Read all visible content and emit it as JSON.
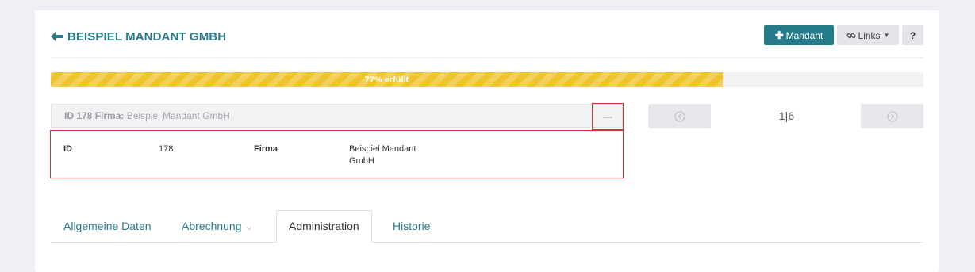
{
  "header": {
    "title": "BEISPIEL MANDANT GMBH",
    "mandant_label": "Mandant",
    "links_label": "Links",
    "help_label": "?"
  },
  "progress": {
    "label": "77% erfüllt",
    "percent": 77,
    "color": "#eec32c"
  },
  "record": {
    "summary_id_label": "ID 178",
    "summary_firma_label": "Firma:",
    "summary_firma_value": "Beispiel Mandant GmbH",
    "collapse_label": "—",
    "fields": {
      "id_label": "ID",
      "id_value": "178",
      "firma_label": "Firma",
      "firma_value": "Beispiel Mandant GmbH"
    }
  },
  "pager": {
    "position": "1|6"
  },
  "tabs": [
    {
      "label": "Allgemeine Daten"
    },
    {
      "label": "Abrechnung"
    },
    {
      "label": "Administration"
    },
    {
      "label": "Historie"
    }
  ],
  "colors": {
    "accent": "#257b89",
    "link": "#2a7a8c",
    "highlight_border": "#d63434"
  }
}
